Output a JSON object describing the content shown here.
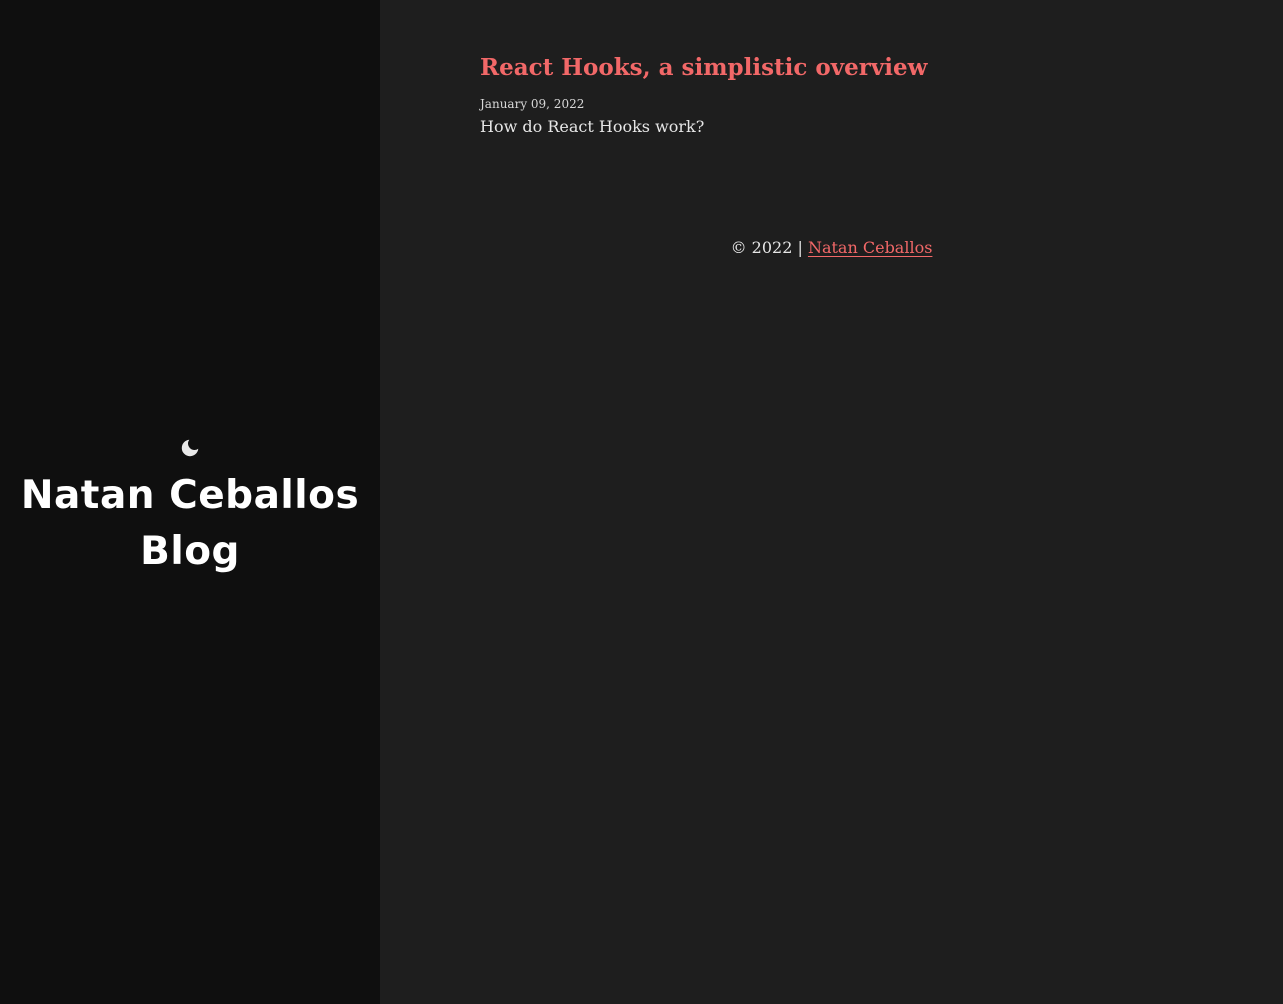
{
  "sidebar": {
    "theme_icon": "moon-icon",
    "title": "Natan Ceballos Blog"
  },
  "posts": [
    {
      "title": "React Hooks, a simplistic overview",
      "date": "January 09, 2022",
      "excerpt": "How do React Hooks work?"
    }
  ],
  "footer": {
    "copyright": "© 2022 | ",
    "author_link": "Natan Ceballos"
  },
  "colors": {
    "accent": "#f26868",
    "sidebar_bg": "#0f0f0f",
    "main_bg": "#1e1e1e",
    "text": "#e6e6e6"
  }
}
